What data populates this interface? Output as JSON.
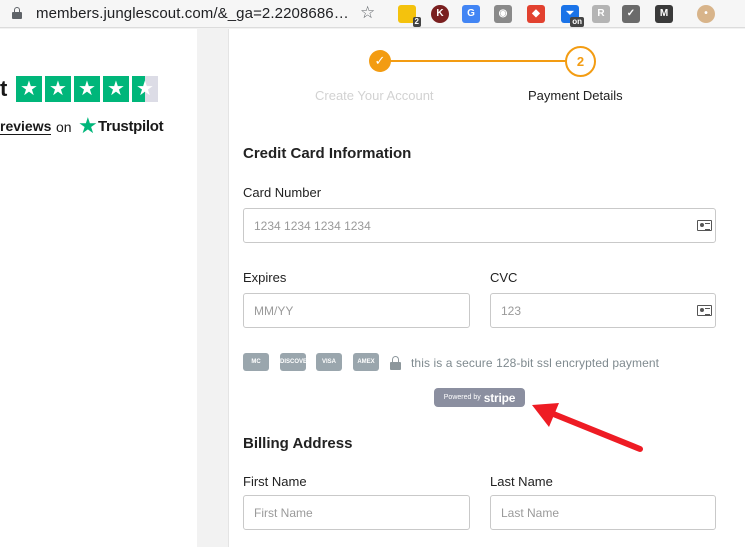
{
  "browser": {
    "url": "members.junglescout.com/&_ga=2.2208686…",
    "extensions": [
      {
        "name": "extension-yellow-icon",
        "text": "",
        "badge": "2",
        "color": "#f4c20d"
      },
      {
        "name": "k-extension-icon",
        "text": "K",
        "badge": "",
        "color": "#7a1f1f"
      },
      {
        "name": "google-translate-icon",
        "text": "G",
        "badge": "",
        "color": "#4285f4"
      },
      {
        "name": "camera-icon",
        "text": "◉",
        "badge": "",
        "color": "#8a8a8a"
      },
      {
        "name": "red-tag-icon",
        "text": "◆",
        "badge": "",
        "color": "#e2412f"
      },
      {
        "name": "on-toggle-extension-icon",
        "text": "⏷",
        "badge": "on",
        "color": "#1a73e8"
      },
      {
        "name": "r-extension-icon",
        "text": "R",
        "badge": "",
        "color": "#b4b4b4"
      },
      {
        "name": "check-circle-icon",
        "text": "✓",
        "badge": "",
        "color": "#6b6b6b"
      },
      {
        "name": "m-extension-icon",
        "text": "M",
        "badge": "",
        "color": "#3a3a3a"
      },
      {
        "name": "profile-avatar-icon",
        "text": "•",
        "badge": "",
        "color": "#d8b48a"
      }
    ]
  },
  "trustpilot": {
    "t_fragment": "t",
    "reviews_fragment": "reviews",
    "on": "on",
    "brand": "Trustpilot",
    "rating_stars": 4.5
  },
  "stepper": {
    "step1_label": "Create Your Account",
    "step1_mark": "✓",
    "step2_label": "Payment Details",
    "step2_number": "2",
    "accent": "#f39c12"
  },
  "payment": {
    "section_title": "Credit Card Information",
    "card_number_label": "Card Number",
    "card_number_placeholder": "1234 1234 1234 1234",
    "expires_label": "Expires",
    "expires_placeholder": "MM/YY",
    "cvc_label": "CVC",
    "cvc_placeholder": "123",
    "card_brands": [
      "MC",
      "DISCOVER",
      "VISA",
      "AMEX"
    ],
    "secure_text": "this is a secure 128-bit ssl encrypted payment",
    "powered_by": "Powered by",
    "stripe": "stripe"
  },
  "billing": {
    "section_title": "Billing Address",
    "first_name_label": "First Name",
    "first_name_placeholder": "First Name",
    "last_name_label": "Last Name",
    "last_name_placeholder": "Last Name"
  }
}
